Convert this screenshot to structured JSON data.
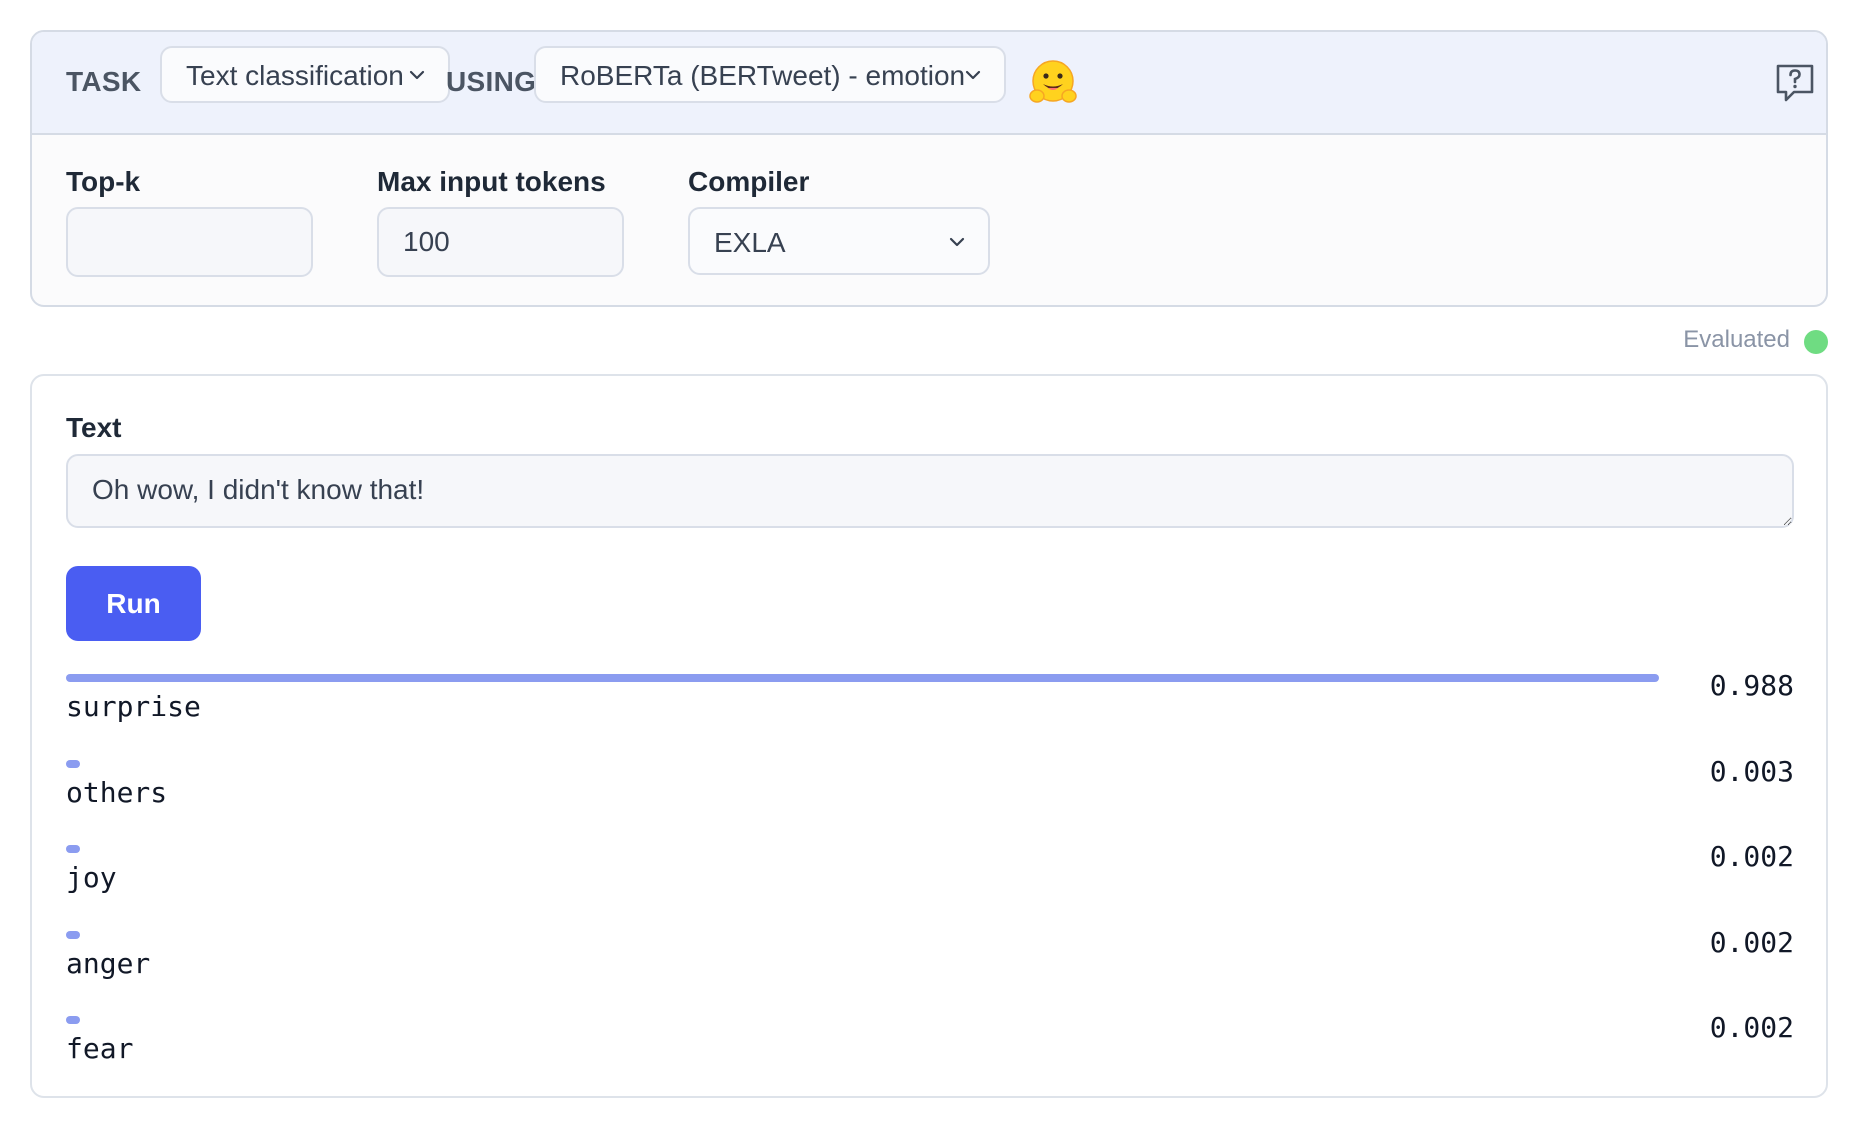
{
  "header": {
    "task_label": "TASK",
    "task_value": "Text classification",
    "using_label": "USING",
    "model_value": "RoBERTa (BERTweet) - emotion",
    "emoji_icon": "hugging-face-emoji",
    "help_icon": "help-icon"
  },
  "options": {
    "topk_label": "Top-k",
    "topk_value": "",
    "max_tokens_label": "Max input tokens",
    "max_tokens_value": "100",
    "compiler_label": "Compiler",
    "compiler_value": "EXLA"
  },
  "status": {
    "text": "Evaluated",
    "color": "#6fdc82"
  },
  "input": {
    "label": "Text",
    "value": "Oh wow, I didn't know that!"
  },
  "run_label": "Run",
  "results": [
    {
      "label": "surprise",
      "score": "0.988",
      "value": 0.988
    },
    {
      "label": "others",
      "score": "0.003",
      "value": 0.003
    },
    {
      "label": "joy",
      "score": "0.002",
      "value": 0.002
    },
    {
      "label": "anger",
      "score": "0.002",
      "value": 0.002
    },
    {
      "label": "fear",
      "score": "0.002",
      "value": 0.002
    }
  ],
  "colors": {
    "accent": "#4a5df2",
    "bar": "#8b9cf0",
    "header_bg": "#eef2fc"
  }
}
